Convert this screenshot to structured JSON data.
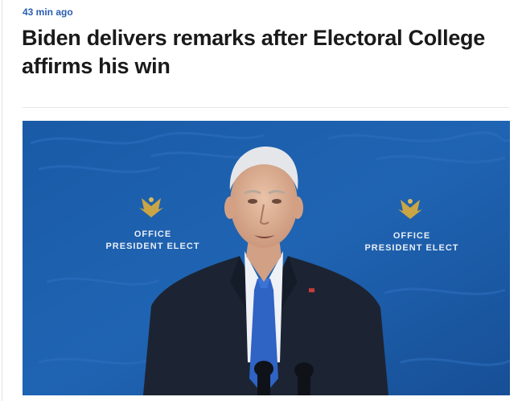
{
  "article": {
    "timestamp": "43 min ago",
    "headline": "Biden delivers remarks after Electoral College affirms his win"
  },
  "image": {
    "backdrop_text_left_line1": "OFFICE",
    "backdrop_text_left_line2": "PRESIDENT ELECT",
    "backdrop_text_right_line1": "OFFICE",
    "backdrop_text_right_line2": "PRESIDENT ELECT",
    "backdrop_color": "#1d5ea8",
    "suit_color": "#1c2433",
    "tie_color": "#2f63c4"
  }
}
